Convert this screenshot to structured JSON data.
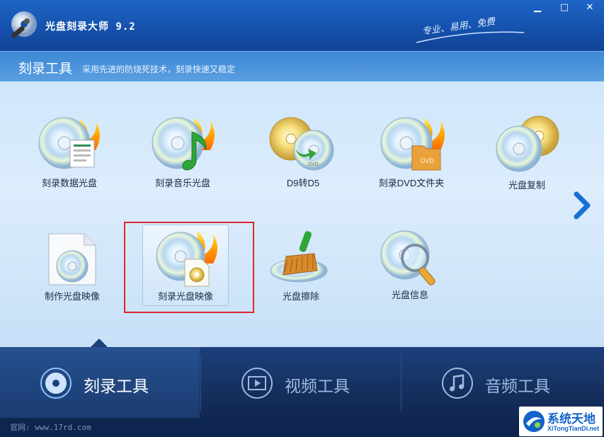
{
  "window": {
    "title": "光盘刻录大师 9.2",
    "slogan": "专业、易用、免费",
    "controls": {
      "minimize": "▁",
      "maximize": "□",
      "close": "✕"
    }
  },
  "section": {
    "title": "刻录工具",
    "subtitle": "采用先进的防烧死技术，刻录快速又稳定"
  },
  "tools": [
    {
      "label": "刻录数据光盘",
      "icon": "data-disc-icon"
    },
    {
      "label": "刻录音乐光盘",
      "icon": "music-disc-icon"
    },
    {
      "label": "D9转D5",
      "icon": "d9-to-d5-icon"
    },
    {
      "label": "刻录DVD文件夹",
      "icon": "dvd-folder-icon"
    },
    {
      "label": "光盘复制",
      "icon": "disc-copy-icon"
    },
    {
      "label": "制作光盘映像",
      "icon": "make-image-icon"
    },
    {
      "label": "刻录光盘映像",
      "icon": "burn-image-icon",
      "selected": true
    },
    {
      "label": "光盘擦除",
      "icon": "erase-disc-icon"
    },
    {
      "label": "光盘信息",
      "icon": "disc-info-icon"
    }
  ],
  "nav": {
    "tabs": [
      {
        "label": "刻录工具",
        "icon": "burn-tools-icon",
        "active": true
      },
      {
        "label": "视频工具",
        "icon": "video-tools-icon",
        "active": false
      },
      {
        "label": "音频工具",
        "icon": "audio-tools-icon",
        "active": false
      }
    ]
  },
  "status": {
    "text": "官网: www.17rd.com"
  },
  "watermark": {
    "title": "系统天地",
    "url": "XiTongTianDi.net"
  },
  "colors": {
    "highlight": "#e0282a",
    "accent": "#1463c8",
    "arrow": "#1a6fd6"
  }
}
